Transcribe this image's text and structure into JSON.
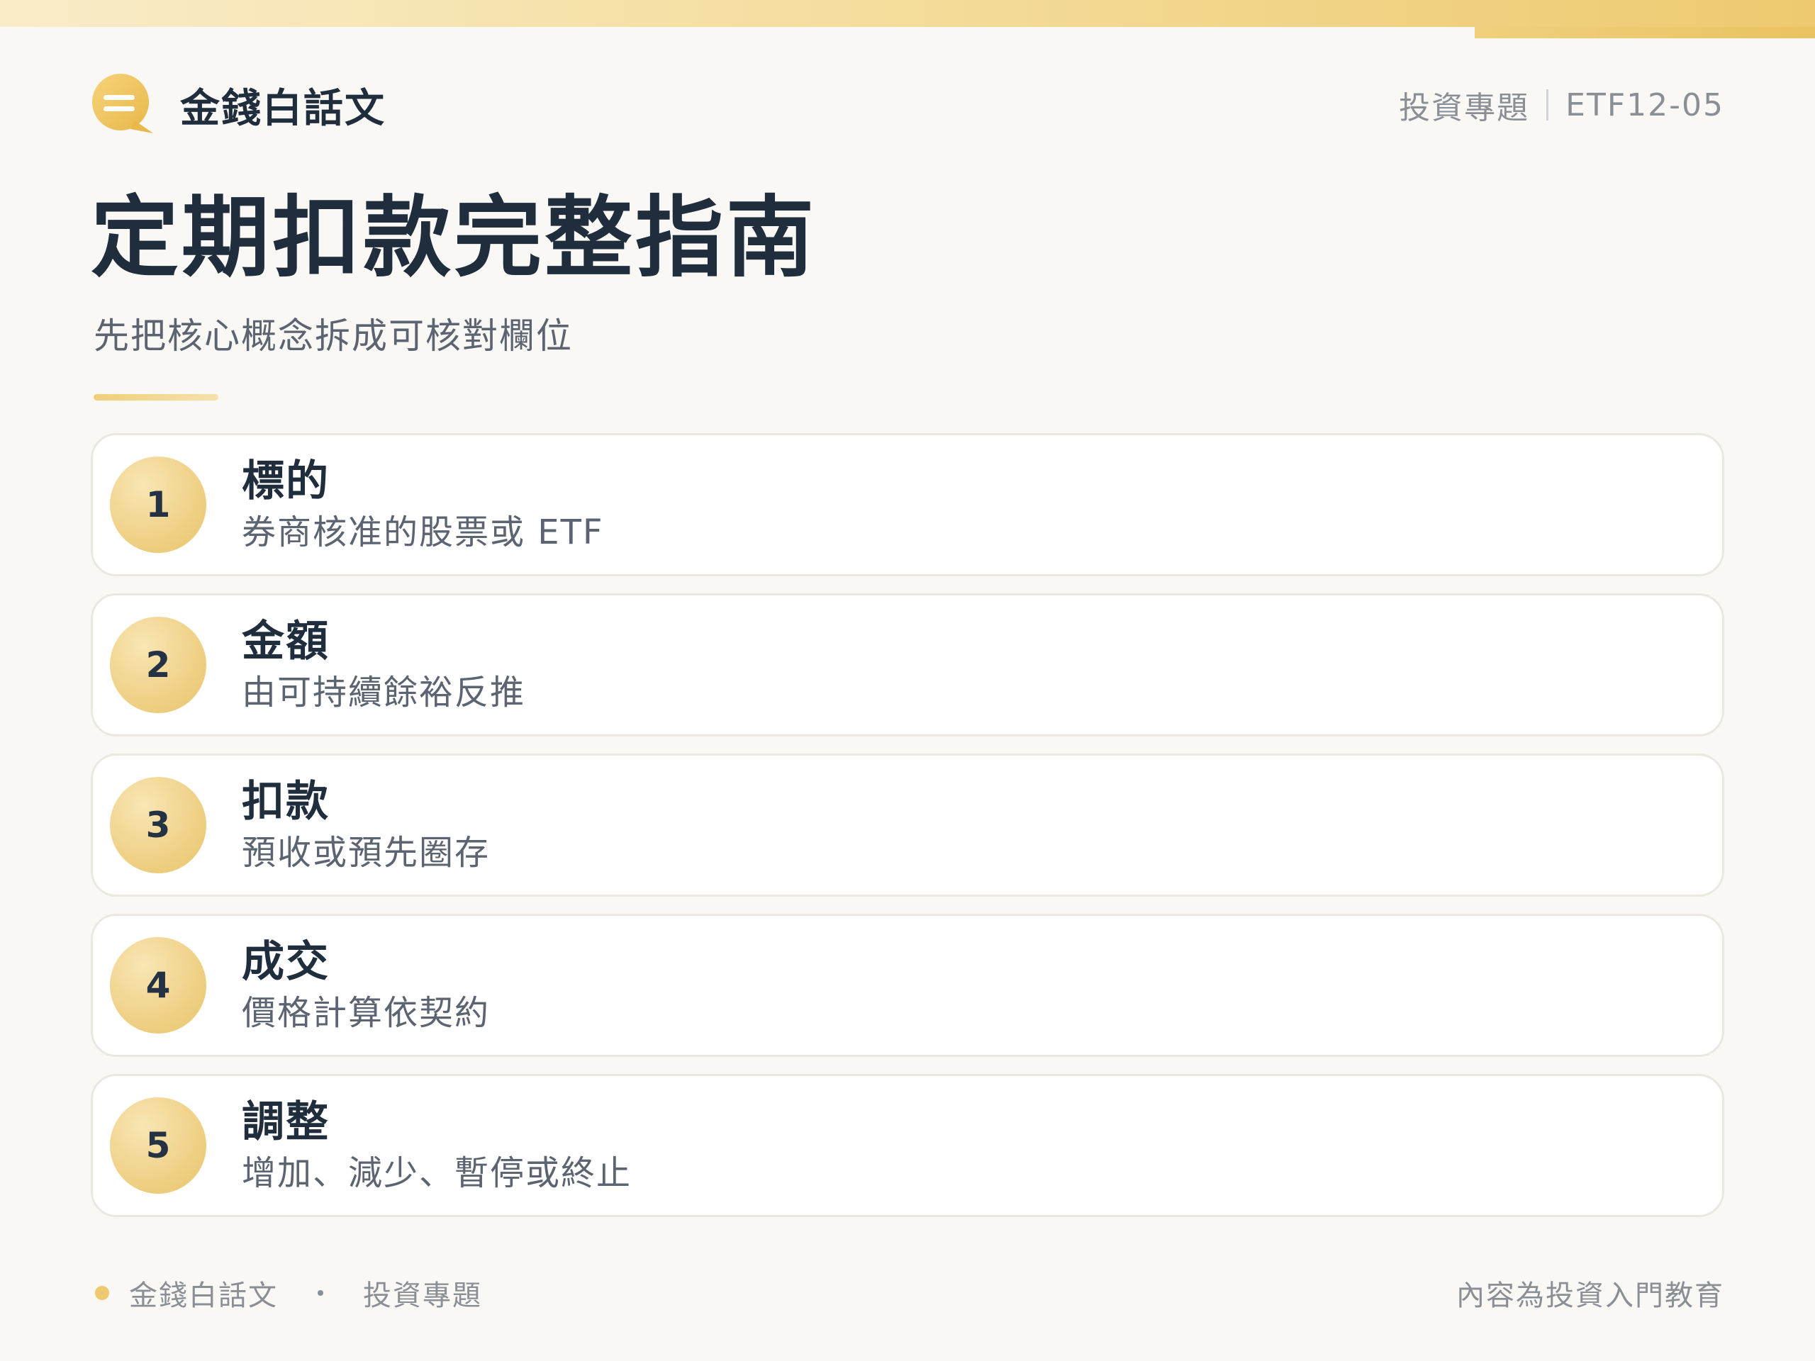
{
  "brand": {
    "name": "金錢白話文",
    "icon": "chat-bubble-icon",
    "accent_color": "#f0c85a"
  },
  "header": {
    "category": "投資專題",
    "code": "ETF12-05"
  },
  "title": "定期扣款完整指南",
  "subtitle": "先把核心概念拆成可核對欄位",
  "steps": [
    {
      "number": "1",
      "title": "標的",
      "desc": "券商核准的股票或 ETF"
    },
    {
      "number": "2",
      "title": "金額",
      "desc": "由可持續餘裕反推"
    },
    {
      "number": "3",
      "title": "扣款",
      "desc": "預收或預先圈存"
    },
    {
      "number": "4",
      "title": "成交",
      "desc": "價格計算依契約"
    },
    {
      "number": "5",
      "title": "調整",
      "desc": "增加、減少、暫停或終止"
    }
  ],
  "footer": {
    "brand": "金錢白話文",
    "category": "投資專題",
    "note": "內容為投資入門教育"
  }
}
